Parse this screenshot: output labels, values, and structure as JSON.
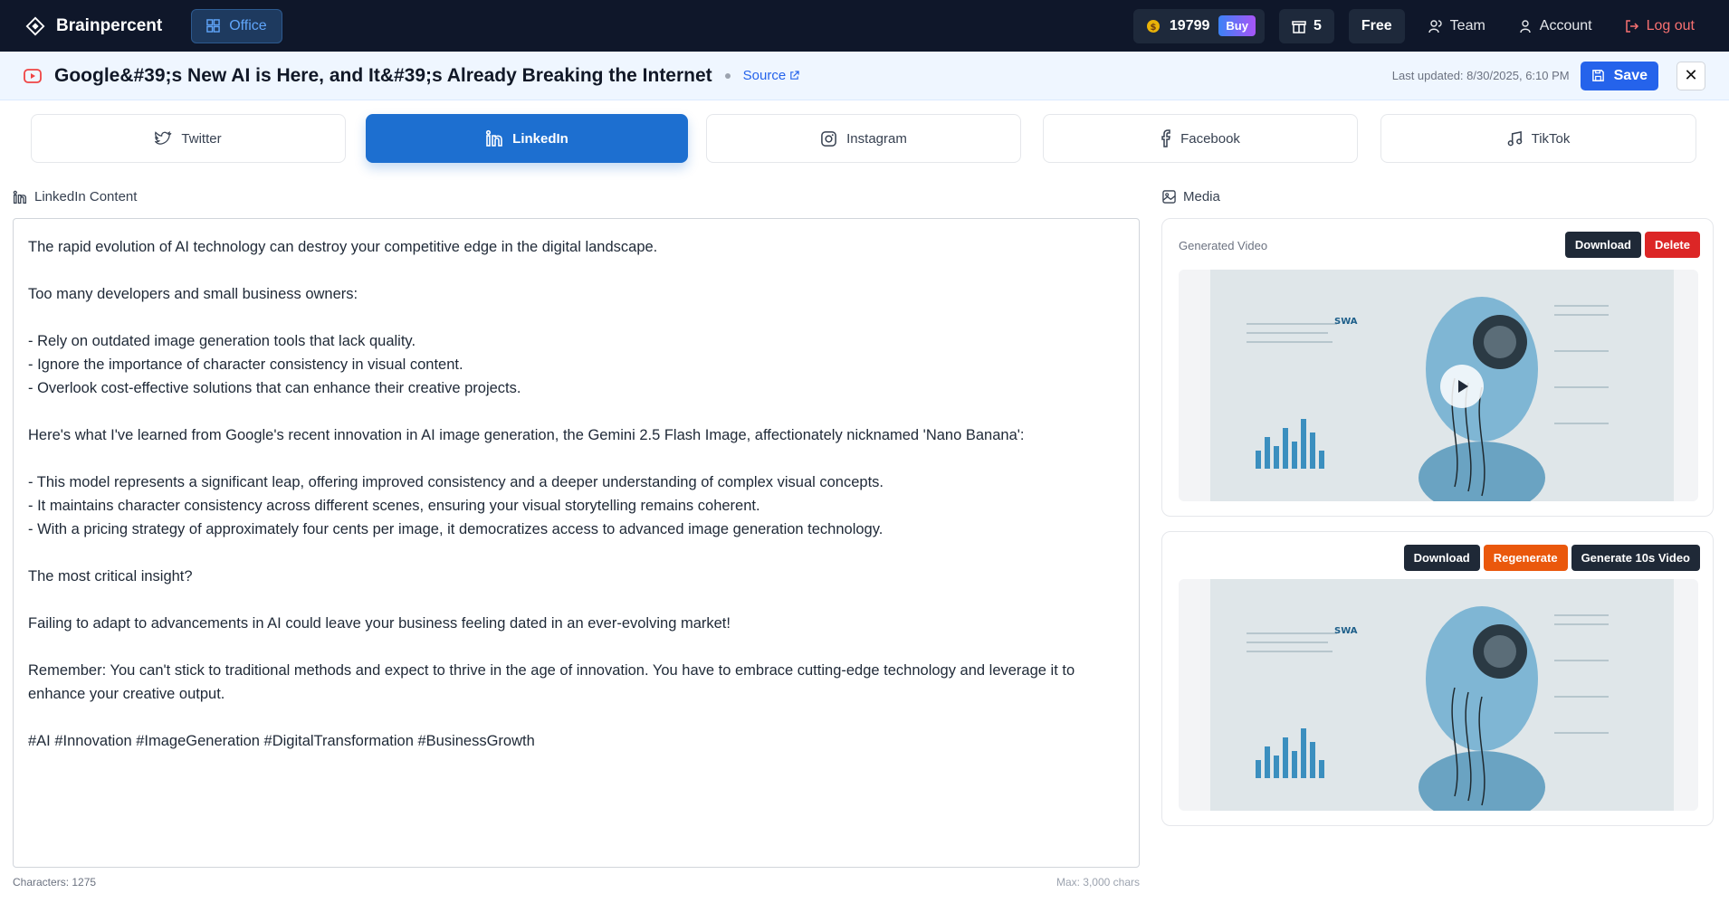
{
  "topbar": {
    "brand": "Brainpercent",
    "office_label": "Office",
    "credits": "19799",
    "buy_label": "Buy",
    "count": "5",
    "plan": "Free",
    "team_label": "Team",
    "account_label": "Account",
    "logout_label": "Log out"
  },
  "header": {
    "title": "Google&#39;s New AI is Here, and It&#39;s Already Breaking the Internet",
    "source_label": "Source",
    "last_updated": "Last updated: 8/30/2025, 6:10 PM",
    "save_label": "Save",
    "close_symbol": "✕"
  },
  "tabs": [
    {
      "label": "Twitter",
      "icon": "twitter-icon",
      "active": false
    },
    {
      "label": "LinkedIn",
      "icon": "linkedin-icon",
      "active": true
    },
    {
      "label": "Instagram",
      "icon": "instagram-icon",
      "active": false
    },
    {
      "label": "Facebook",
      "icon": "facebook-icon",
      "active": false
    },
    {
      "label": "TikTok",
      "icon": "tiktok-icon",
      "active": false
    }
  ],
  "content": {
    "heading": "LinkedIn Content",
    "lines": [
      "The rapid evolution of AI technology can destroy your competitive edge in the digital landscape.",
      "",
      "Too many developers and small business owners:",
      "",
      "- Rely on outdated image generation tools that lack quality.",
      "- Ignore the importance of character consistency in visual content.",
      "- Overlook cost-effective solutions that can enhance their creative projects.",
      "",
      "Here's what I've learned from Google's recent innovation in AI image generation, the Gemini 2.5 Flash Image, affectionately nicknamed 'Nano Banana':",
      "",
      "- This model represents a significant leap, offering improved consistency and a deeper understanding of complex visual concepts.",
      "- It maintains character consistency across different scenes, ensuring your visual storytelling remains coherent.",
      "- With a pricing strategy of approximately four cents per image, it democratizes access to advanced image generation technology.",
      "",
      "The most critical insight?",
      "",
      "Failing to adapt to advancements in AI could leave your business feeling dated in an ever-evolving market!",
      "",
      "Remember: You can't stick to traditional methods and expect to thrive in the age of innovation. You have to embrace cutting-edge technology and leverage it to",
      "enhance your creative output.",
      "",
      "#AI #Innovation #ImageGeneration #DigitalTransformation #BusinessGrowth"
    ],
    "characters": "Characters: 1275",
    "max": "Max: 3,000 chars"
  },
  "media": {
    "heading": "Media",
    "video_card": {
      "label": "Generated Video",
      "download_label": "Download",
      "delete_label": "Delete"
    },
    "image_card": {
      "download_label": "Download",
      "regenerate_label": "Regenerate",
      "generate_label": "Generate 10s Video"
    }
  },
  "colors": {
    "topbar": "#0f172a",
    "accent": "#2563eb",
    "linkedin_active": "#1d6fd0",
    "danger": "#dc2626",
    "warning": "#ea580c"
  }
}
